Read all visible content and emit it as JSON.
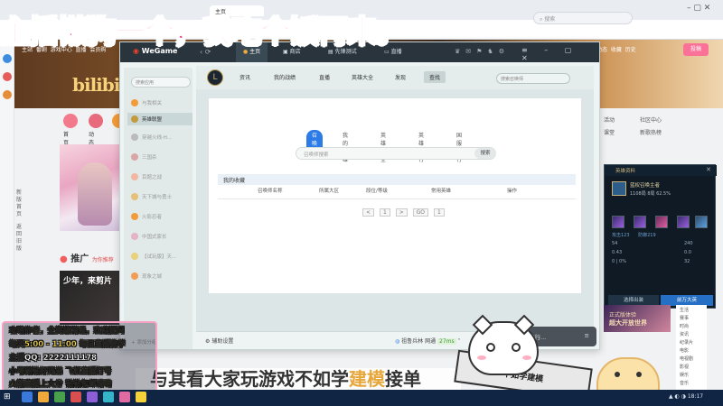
{
  "overlay": {
    "headline": "主播懒狗一个，我吃个饭再来。",
    "info_lines": [
      "攻略作者，全英雄精通，欢迎提问",
      "每天5:00 - 11:00 每日直播教学",
      "主播QQ: 2222111178",
      "小号刷钻好兄弟   飞机直播打号",
      "火箭直播上大分   钻钻包邮请哟"
    ],
    "bottom_banner_pre": "与其看大家玩游戏不如学",
    "bottom_banner_hl": "建模",
    "bottom_banner_post": "接单",
    "sticker_text": "不如学建模"
  },
  "browser": {
    "address": "搜索",
    "tab_title": "主页",
    "bookmarks": [
      "主站",
      "番剧",
      "游戏中心",
      "直播",
      "会员购",
      "漫画",
      "赛事"
    ],
    "right_nav": [
      "动态",
      "收藏",
      "历史",
      "创作中心"
    ],
    "upload": "投稿",
    "logo": "bilibili"
  },
  "bili": {
    "categories": [
      {
        "label": "首页",
        "color": "#f27a8b"
      },
      {
        "label": "动态",
        "color": "#e86a7d"
      },
      {
        "label": "热门",
        "color": "#f39b3a"
      }
    ],
    "right_cats": [
      "专栏",
      "活动",
      "社区中心",
      "课堂",
      "新歌热榜",
      "音乐"
    ],
    "push_label": "推广",
    "push_sub": "为你推荐",
    "video2_caption": "少年，来剪片",
    "side_tags": [
      "新版首页",
      "返回旧版"
    ]
  },
  "wegame": {
    "app_name": "WeGame",
    "nav": [
      "主页",
      "商店",
      "先锋测试",
      "直播"
    ],
    "search_placeholder": "搜索应用",
    "sidebar": [
      {
        "label": "与我相关",
        "on": false
      },
      {
        "label": "英雄联盟",
        "on": true
      },
      {
        "label": "穿越火线·H...",
        "on": false
      },
      {
        "label": "三国杀",
        "on": false
      },
      {
        "label": "百题之战",
        "on": false
      },
      {
        "label": "天下城与勇士",
        "on": false
      },
      {
        "label": "火影忍者",
        "on": false
      },
      {
        "label": "中国式家长",
        "on": false
      },
      {
        "label": "【试玩版】天...",
        "on": false
      },
      {
        "label": "现象之城",
        "on": false
      }
    ],
    "lol_tabs": [
      "资讯",
      "我的战绩",
      "直播",
      "英雄大全",
      "发现",
      "查找"
    ],
    "lol_search": "搜索召唤师",
    "subtabs": [
      "召唤师",
      "我的英雄",
      "英雄大全",
      "英雄排行",
      "国服排行"
    ],
    "summoner_placeholder": "召唤师搜索",
    "search_btn": "搜索",
    "records_title": "我的收藏",
    "record_columns": [
      "召唤师名称",
      "所属大区",
      "段位/等级",
      "常用英雄",
      "操作"
    ],
    "pager": [
      "<",
      "1",
      ">",
      "GO",
      "1"
    ],
    "bottom_left": "辅助设置",
    "bottom_game": "祖鲁兵林 网通",
    "bottom_ping": "27ms",
    "running": "正在运行...",
    "add_group": "添加分组"
  },
  "lol_mini": {
    "header": "英雄资料",
    "name": "蓝权召唤主者",
    "stats": "1108局   8局   62.5%",
    "kda_rows": [
      {
        "left": "54",
        "right": "240"
      },
      {
        "left": "0.43",
        "right": "0.0"
      },
      {
        "left": "0 | 0%",
        "right": "32"
      }
    ],
    "tags": [
      "攻击123",
      "防御219"
    ],
    "btn_left": "选择出装",
    "btn_right": "前万大英"
  },
  "promo": {
    "title": "正式版体验",
    "subtitle": "超大开放世界"
  },
  "right_list": [
    "生活",
    "赛事",
    "时尚",
    "资讯",
    "纪录片",
    "电影",
    "电视剧",
    "影视",
    "娱乐",
    "音乐"
  ],
  "taskbar": {
    "time": "18:17",
    "icons": [
      {
        "color": "#3b79d8"
      },
      {
        "color": "#f0a93b"
      },
      {
        "color": "#4aa04a"
      },
      {
        "color": "#d94f4f"
      },
      {
        "color": "#8c5fd6"
      },
      {
        "color": "#35b4c9"
      },
      {
        "color": "#e26aa2"
      },
      {
        "color": "#f5d13b"
      }
    ]
  }
}
